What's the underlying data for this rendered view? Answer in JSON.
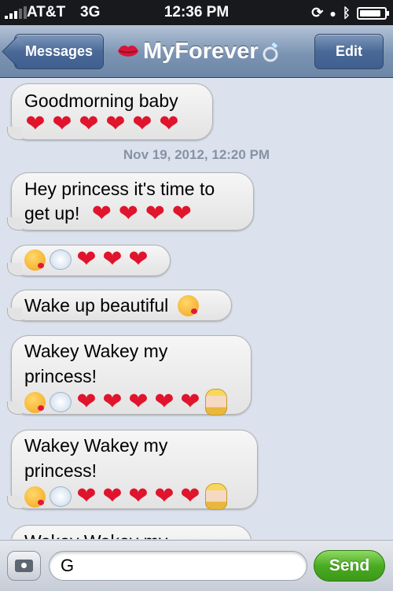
{
  "status_bar": {
    "carrier": "AT&T",
    "network": "3G",
    "time": "12:36 PM",
    "battery_level": 0.85
  },
  "nav": {
    "back_label": "Messages",
    "title": "MyForever",
    "edit_label": "Edit",
    "title_prefix_icon": "lips-icon",
    "title_suffix_icon": "ring-icon"
  },
  "thread": {
    "messages": [
      {
        "text_lines": [
          "Goodmorning baby"
        ],
        "emoji": [
          "heart",
          "heart",
          "heart",
          "heart",
          "heart",
          "heart"
        ]
      },
      {
        "text_lines": [
          "Hey princess it's time to",
          "get up!"
        ],
        "emoji": [
          "heart",
          "heart",
          "heart",
          "heart"
        ]
      },
      {
        "text_lines": [],
        "emoji": [
          "kiss",
          "dash",
          "heart",
          "heart",
          "heart"
        ]
      },
      {
        "text_lines": [
          "Wake up beautiful"
        ],
        "emoji": [
          "kiss"
        ]
      },
      {
        "text_lines": [
          "Wakey Wakey my",
          "princess!"
        ],
        "emoji": [
          "kiss",
          "dash",
          "heart",
          "heart",
          "heart",
          "heart",
          "heart",
          "princess"
        ]
      },
      {
        "text_lines": [
          "Wakey Wakey my",
          "princess!"
        ],
        "emoji": [
          "kiss",
          "dash",
          "heart",
          "heart",
          "heart",
          "heart",
          "heart",
          "princess"
        ]
      },
      {
        "text_lines": [
          "Wakey Wakey my"
        ],
        "emoji": []
      }
    ],
    "timestamp": "Nov 19, 2012, 12:20 PM"
  },
  "composer": {
    "value": "G",
    "send_label": "Send",
    "camera_icon": "camera-icon"
  },
  "colors": {
    "nav_blue": "#6d86a7",
    "send_green": "#4aac22",
    "heart_red": "#e0142c",
    "timestamp_gray": "#8792a4"
  }
}
